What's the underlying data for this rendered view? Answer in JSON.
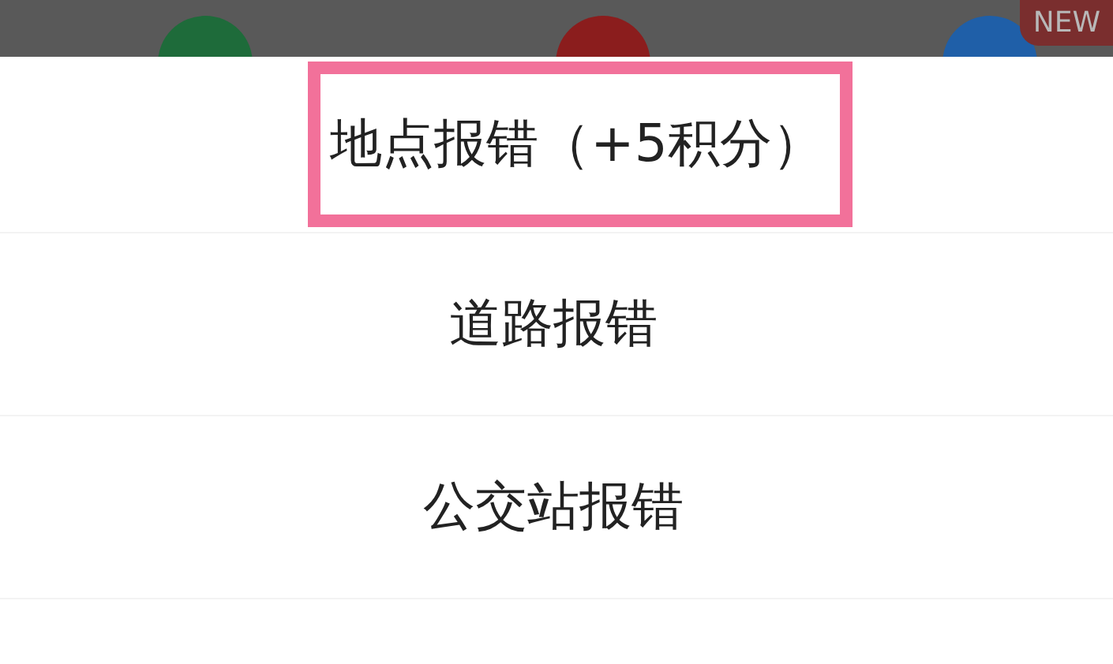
{
  "background": {
    "badge": "NEW",
    "icons": [
      {
        "color": "#1e6b3a"
      },
      {
        "color": "#8b1d1d"
      },
      {
        "color": "#1f5fa8"
      }
    ]
  },
  "menu": {
    "items": [
      {
        "label": "地点报错（+5积分）",
        "highlighted": true
      },
      {
        "label": "道路报错",
        "highlighted": false
      },
      {
        "label": "公交站报错",
        "highlighted": false
      }
    ]
  }
}
